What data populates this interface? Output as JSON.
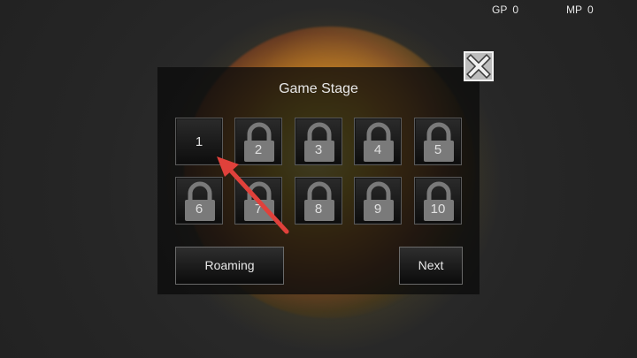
{
  "hud": {
    "gp_label": "GP",
    "gp_value": "0",
    "mp_label": "MP",
    "mp_value": "0"
  },
  "dialog": {
    "title": "Game Stage",
    "stages": [
      {
        "label": "1",
        "locked": false
      },
      {
        "label": "2",
        "locked": true
      },
      {
        "label": "3",
        "locked": true
      },
      {
        "label": "4",
        "locked": true
      },
      {
        "label": "5",
        "locked": true
      },
      {
        "label": "6",
        "locked": true
      },
      {
        "label": "7",
        "locked": true
      },
      {
        "label": "8",
        "locked": true
      },
      {
        "label": "9",
        "locked": true
      },
      {
        "label": "10",
        "locked": true
      }
    ],
    "roaming_label": "Roaming",
    "next_label": "Next",
    "close_icon": "close-x-icon",
    "lock_icon": "padlock-icon"
  },
  "colors": {
    "arrow": "#e0413b",
    "panel_bg": "#0c0c0c",
    "text": "#e8e8e8"
  }
}
